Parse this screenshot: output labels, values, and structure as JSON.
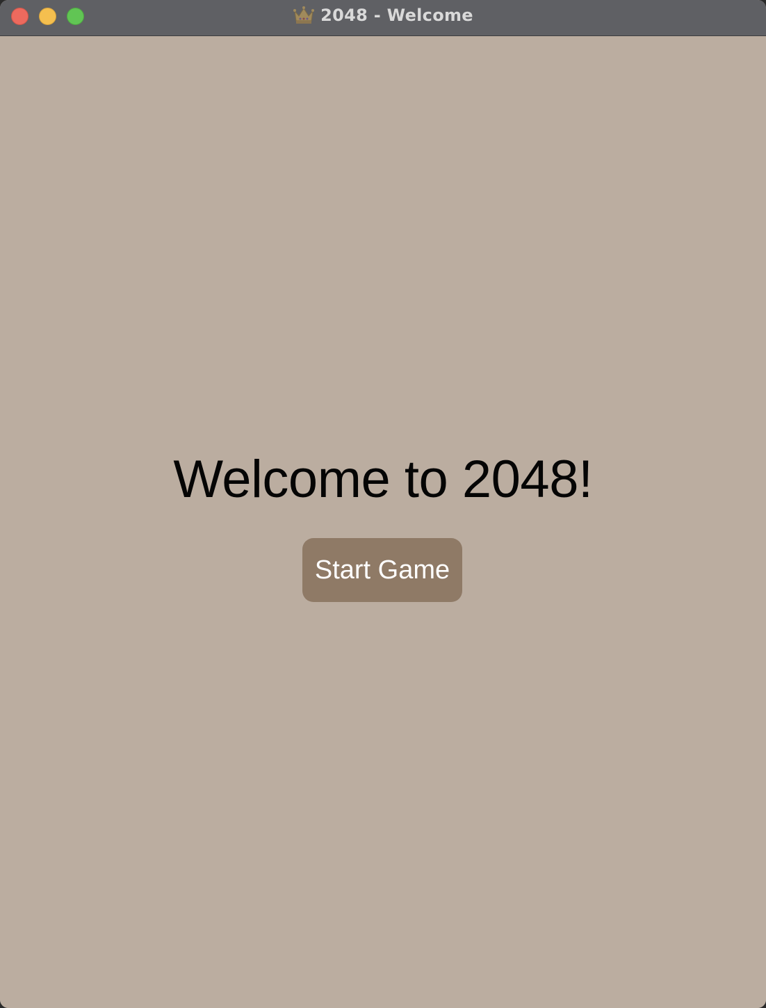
{
  "window": {
    "title": "2048 - Welcome",
    "title_icon": "crown-icon",
    "controls": [
      "close",
      "minimize",
      "zoom"
    ],
    "background_color": "#bbada0",
    "titlebar_color": "#5f6064"
  },
  "main": {
    "heading": "Welcome to 2048!",
    "start_button_label": "Start Game",
    "button_color": "#8f7a66",
    "button_text_color": "#ffffff"
  }
}
